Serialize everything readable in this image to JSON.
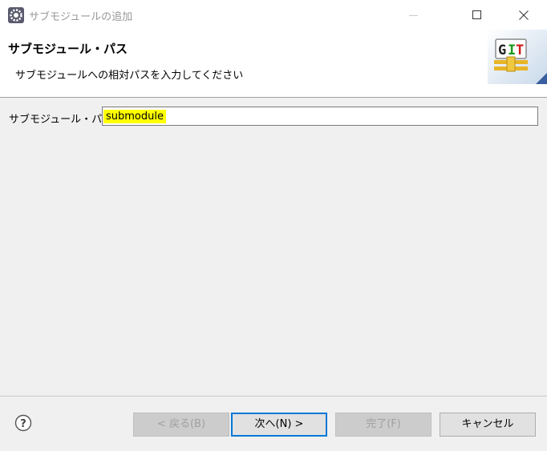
{
  "window": {
    "title": "サブモジュールの追加",
    "app_icon": "eclipse-gear-icon",
    "controls": [
      "minimize-icon",
      "maximize-icon",
      "close-icon"
    ]
  },
  "banner": {
    "title": "サブモジュール・パス",
    "message": "サブモジュールへの相対パスを入力してください",
    "logo_text": "GIT",
    "logo_text_colors": {
      "G": "#222222",
      "I": "#1a9a1a",
      "T": "#d11a1a"
    }
  },
  "form": {
    "label": "サブモジュール・パス:",
    "value": "submodule",
    "highlight_color": "#ffff00"
  },
  "buttons": {
    "back": "< 戻る(B)",
    "next": "次へ(N) >",
    "finish": "完了(F)",
    "cancel": "キャンセル"
  },
  "help_icon": "question-circle-icon",
  "accent_color": "#0078d7"
}
